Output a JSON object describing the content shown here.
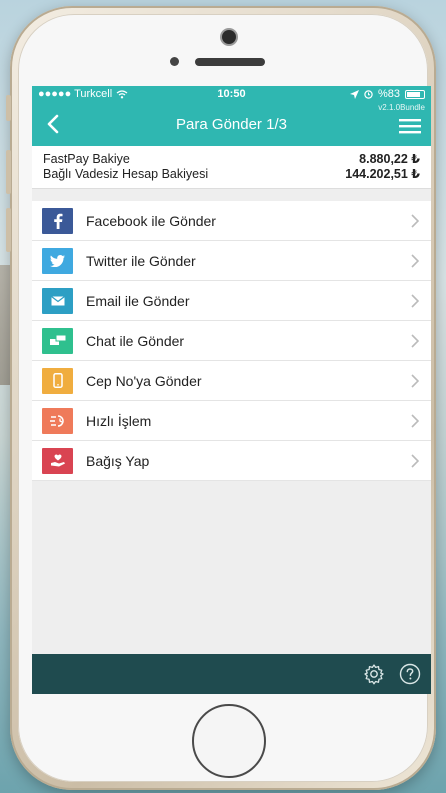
{
  "status_bar": {
    "carrier": "●●●●● Turkcell",
    "time": "10:50",
    "battery_text": "%83",
    "battery_level": 0.83
  },
  "nav": {
    "title": "Para Gönder 1/3",
    "version": "v2.1.0Bundle"
  },
  "balances": [
    {
      "label": "FastPay Bakiye",
      "value": "8.880,22 ₺"
    },
    {
      "label": "Bağlı Vadesiz Hesap Bakiyesi",
      "value": "144.202,51 ₺"
    }
  ],
  "menu": [
    {
      "label": "Facebook ile Gönder",
      "icon": "facebook-icon",
      "color": "#3b5998"
    },
    {
      "label": "Twitter ile Gönder",
      "icon": "twitter-icon",
      "color": "#3fa9e0"
    },
    {
      "label": "Email ile Gönder",
      "icon": "email-icon",
      "color": "#2d9fc4"
    },
    {
      "label": "Chat ile Gönder",
      "icon": "chat-icon",
      "color": "#2fc08e"
    },
    {
      "label": "Cep No'ya Gönder",
      "icon": "mobile-phone-icon",
      "color": "#f0ad3f"
    },
    {
      "label": "Hızlı İşlem",
      "icon": "fast-transaction-icon",
      "color": "#ef7a5a"
    },
    {
      "label": "Bağış Yap",
      "icon": "donate-icon",
      "color": "#d94452"
    }
  ],
  "colors": {
    "accent": "#2fb7b1",
    "footer": "#1f4b4f"
  },
  "footer_icons": [
    "gear-icon",
    "help-icon"
  ]
}
